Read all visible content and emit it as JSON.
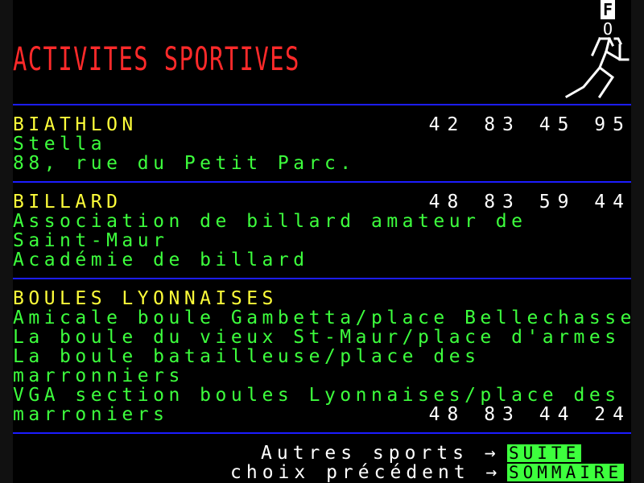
{
  "header": {
    "title": "ACTIVITES SPORTIVES",
    "badge_top": "F",
    "badge_bottom": "O",
    "logo": "running-man-icon"
  },
  "sections": [
    {
      "name": "BIATHLON",
      "phone": "42 83 45 95",
      "lines": [
        "Stella",
        "88, rue du Petit Parc."
      ]
    },
    {
      "name": "BILLARD",
      "phone": "48 83 59 44",
      "lines": [
        "Association de billard amateur de",
        "Saint-Maur",
        "Académie de billard"
      ]
    },
    {
      "name": "BOULES LYONNAISES",
      "phone": "48 83 44 24",
      "lines": [
        "Amicale boule Gambetta/place Bellechasse",
        "La boule du vieux St-Maur/place d'armes",
        "La boule batailleuse/place des",
        "marronniers",
        "VGA section boules Lyonnaises/place des",
        "marroniers"
      ]
    }
  ],
  "footer": {
    "next_label": "Autres sports →",
    "next_button": "SUITE",
    "back_label": "choix précédent →",
    "back_button": "SOMMAIRE"
  },
  "colors": {
    "title": "#ff2a2a",
    "heading": "#ffff3a",
    "text": "#3dff3d",
    "rule": "#1c1cff",
    "button_bg": "#3dff3d"
  }
}
